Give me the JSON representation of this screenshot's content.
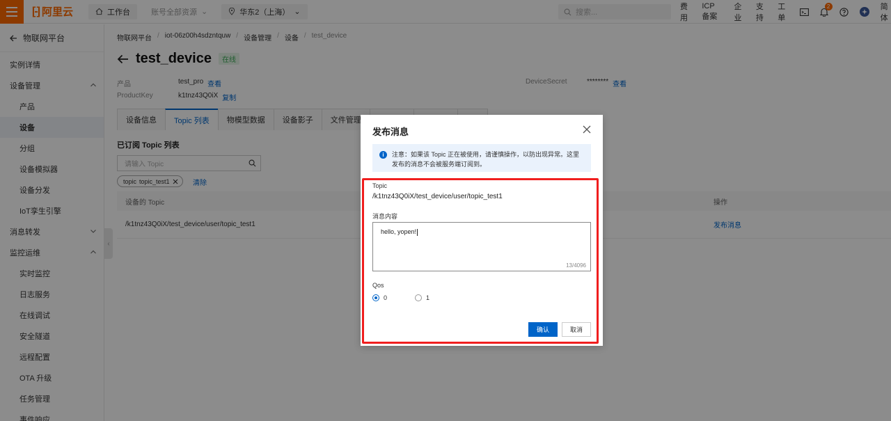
{
  "topbar": {
    "logo_text": "阿里云",
    "workbench": "工作台",
    "account_resources": "账号全部资源",
    "region": "华东2（上海）",
    "search_placeholder": "搜索...",
    "links": [
      "费用",
      "ICP 备案",
      "企业",
      "支持",
      "工单"
    ],
    "bell_count": "2",
    "language": "简体"
  },
  "sidebar": {
    "back_label": "物联网平台",
    "items": [
      {
        "label": "实例详情",
        "level": 0
      },
      {
        "label": "设备管理",
        "level": 0,
        "expanded": true
      },
      {
        "label": "产品",
        "level": 1
      },
      {
        "label": "设备",
        "level": 1,
        "active": true
      },
      {
        "label": "分组",
        "level": 1
      },
      {
        "label": "设备模拟器",
        "level": 1
      },
      {
        "label": "设备分发",
        "level": 1
      },
      {
        "label": "IoT孪生引擎",
        "level": 1
      },
      {
        "label": "消息转发",
        "level": 0,
        "expanded": false
      },
      {
        "label": "监控运维",
        "level": 0,
        "expanded": true
      },
      {
        "label": "实时监控",
        "level": 1
      },
      {
        "label": "日志服务",
        "level": 1
      },
      {
        "label": "在线调试",
        "level": 1
      },
      {
        "label": "安全隧道",
        "level": 1
      },
      {
        "label": "远程配置",
        "level": 1
      },
      {
        "label": "OTA 升级",
        "level": 1
      },
      {
        "label": "任务管理",
        "level": 1
      },
      {
        "label": "事件响应",
        "level": 1
      }
    ]
  },
  "main": {
    "breadcrumb": [
      "物联网平台",
      "iot-06z00h4sdzntquw",
      "设备管理",
      "设备",
      "test_device"
    ],
    "device_name": "test_device",
    "status": "在线",
    "product_label": "产品",
    "product_value": "test_pro",
    "product_link": "查看",
    "productkey_label": "ProductKey",
    "productkey_value": "k1tnz43Q0iX",
    "productkey_link": "复制",
    "secret_label": "DeviceSecret",
    "secret_value": "********",
    "secret_link": "查看",
    "tabs": [
      "设备信息",
      "Topic 列表",
      "物模型数据",
      "设备影子",
      "文件管理",
      "",
      "",
      "",
      ""
    ],
    "active_tab": 1,
    "section_title": "已订阅 Topic 列表",
    "topic_search_placeholder": "请输入 Topic",
    "filter_tag_key": "topic",
    "filter_tag_value": "topic_test1",
    "filter_clear": "清除",
    "table_header_topic": "设备的 Topic",
    "table_header_action": "操作",
    "table_row_topic": "/k1tnz43Q0iX/test_device/user/topic_test1",
    "table_row_action": "发布消息"
  },
  "dialog": {
    "title": "发布消息",
    "notice": "注意：如果该 Topic 正在被使用，请谨慎操作，以防出现异常。这里发布的消息不会被服务端订阅到。",
    "topic_label": "Topic",
    "topic_value": "/k1tnz43Q0iX/test_device/user/topic_test1",
    "content_label": "消息内容",
    "content_value": "hello, yopen!",
    "counter": "13/4096",
    "qos_label": "Qos",
    "qos_options": [
      "0",
      "1"
    ],
    "qos_selected": "0",
    "ok_label": "确认",
    "cancel_label": "取消"
  },
  "colors": {
    "brand": "#ff6a00",
    "primary": "#0064c8",
    "highlight": "#f01e1e"
  }
}
